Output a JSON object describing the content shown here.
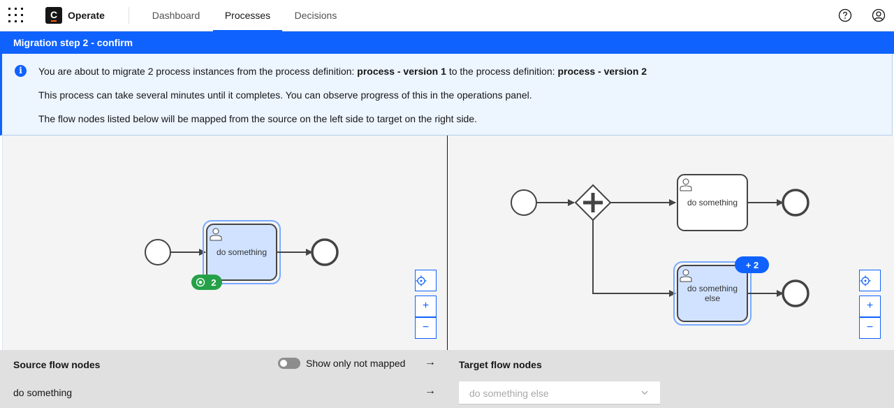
{
  "header": {
    "brand": "Operate",
    "tabs": [
      {
        "label": "Dashboard",
        "active": false
      },
      {
        "label": "Processes",
        "active": true
      },
      {
        "label": "Decisions",
        "active": false
      }
    ],
    "icons": [
      "app-switcher-icon",
      "help-icon",
      "user-icon"
    ]
  },
  "step_bar": {
    "title": "Migration step 2 - confirm"
  },
  "notification": {
    "line1_prefix": "You are about to migrate 2 process instances from the process definition:",
    "source_definition": "process - version 1",
    "line1_middle": "to the process definition:",
    "target_definition": "process - version 2",
    "line2": "This process can take several minutes until it completes. You can observe progress of this in the operations panel.",
    "line3": "The flow nodes listed below will be mapped from the source on the left side to target on the right side."
  },
  "source_diagram": {
    "task_label": "do something",
    "instance_badge_count": "2"
  },
  "target_diagram": {
    "task1_label": "do something",
    "task2_label_line1": "do something",
    "task2_label_line2": "else",
    "added_badge": "+ 2"
  },
  "zoom_controls": {
    "reset": "⌖",
    "zoom_in": "+",
    "zoom_out": "−"
  },
  "mapping": {
    "source_header": "Source flow nodes",
    "target_header": "Target flow nodes",
    "toggle_label": "Show only not mapped",
    "toggle_on": false,
    "rows": [
      {
        "source": "do something",
        "target_value": "do something else"
      }
    ]
  },
  "colors": {
    "accent": "#0f62fe",
    "success": "#24a148",
    "selected_fill": "#d0e2ff"
  }
}
